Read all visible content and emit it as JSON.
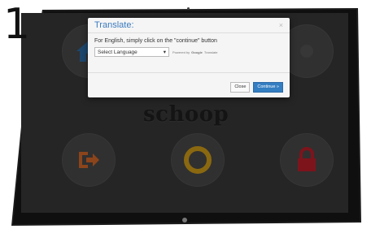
{
  "step": {
    "number": "1"
  },
  "app": {
    "logo_text": "schoop",
    "tiles": [
      {
        "icon": "home-icon",
        "color": "#2f6ea7",
        "label": ""
      },
      {
        "icon": "blank-icon",
        "color": "#555555",
        "label": ""
      },
      {
        "icon": "logout-icon",
        "color": "#d7692a",
        "label": ""
      },
      {
        "icon": "lifebuoy-icon",
        "color": "#d4a01a",
        "label": ""
      },
      {
        "icon": "lock-icon",
        "color": "#c1202b",
        "label": ""
      }
    ]
  },
  "modal": {
    "title": "Translate:",
    "close_symbol": "×",
    "instruction": "For English, simply click on the \"continue\" button",
    "select": {
      "value": "Select Language",
      "arrow": "▾"
    },
    "powered_by": "Powered by",
    "google_text": "Google",
    "translate_text": "Translate",
    "buttons": {
      "close": "Close",
      "continue": "Continue »"
    }
  },
  "colors": {
    "accent": "#347ec2",
    "title": "#3b7bbf"
  }
}
